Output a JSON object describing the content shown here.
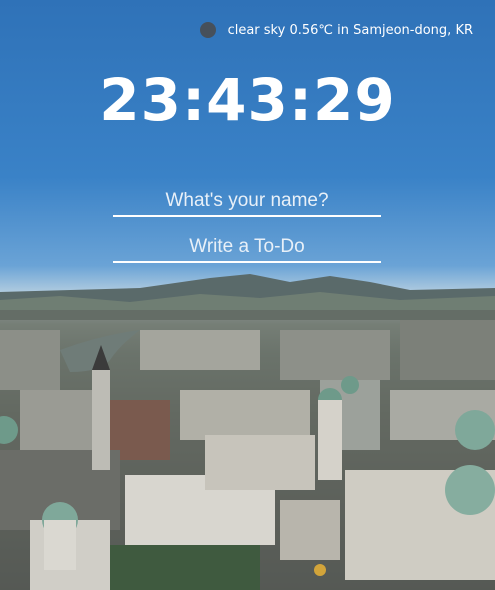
{
  "weather": {
    "icon": "weather-icon",
    "text": "clear sky 0.56℃ in Samjeon-dong, KR"
  },
  "clock": {
    "time": "23:43:29"
  },
  "name_form": {
    "placeholder": "What's your name?"
  },
  "todo_form": {
    "placeholder": "Write a To-Do"
  },
  "colors": {
    "sky": "#2f72b8",
    "text": "#ffffff"
  }
}
